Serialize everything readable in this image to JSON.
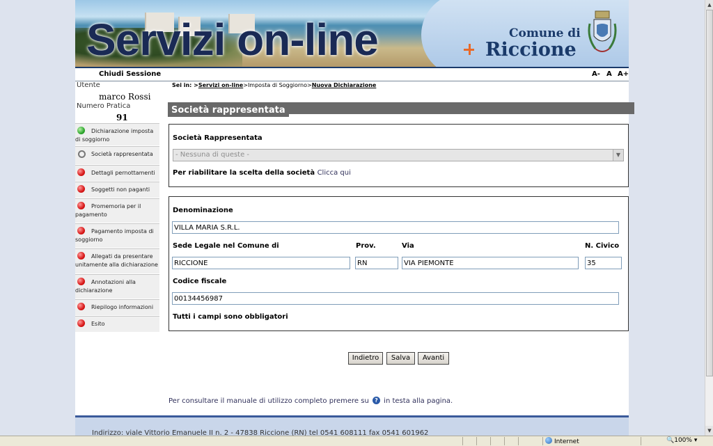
{
  "banner": {
    "title": "Servizi on-line",
    "comune_di": "Comune di",
    "riccione": "Riccione"
  },
  "topbar": {
    "close_session": "Chiudi Sessione",
    "font_smaller": "A-",
    "font_normal": "A",
    "font_larger": "A+"
  },
  "user": {
    "label": "Utente",
    "name": "marco Rossi",
    "practice_label": "Numero Pratica",
    "practice_number": "91"
  },
  "sidebar": {
    "items": [
      {
        "label": "Dichiarazione imposta di soggiorno",
        "status": "done"
      },
      {
        "label": "Società rappresentata",
        "status": "current"
      },
      {
        "label": "Dettagli pernottamenti",
        "status": "todo"
      },
      {
        "label": "Soggetti non paganti",
        "status": "todo"
      },
      {
        "label": "Promemoria per il pagamento",
        "status": "todo"
      },
      {
        "label": "Pagamento imposta di soggiorno",
        "status": "todo"
      },
      {
        "label": "Allegati da presentare unitamente alla dichiarazione",
        "status": "todo"
      },
      {
        "label": "Annotazioni alla dichiarazione",
        "status": "todo"
      },
      {
        "label": "Riepilogo informazioni",
        "status": "todo"
      },
      {
        "label": "Esito",
        "status": "todo"
      }
    ]
  },
  "breadcrumb": {
    "prefix": "Sei in: >",
    "item1": "Servizi on-line",
    "sep1": ">",
    "item2": "Imposta di Soggiorno",
    "sep2": ">",
    "item3": "Nuova Dichiarazione"
  },
  "section": {
    "title": "Società rappresentata"
  },
  "company_select": {
    "label": "Società Rappresentata",
    "selected": "- Nessuna di queste -",
    "reenable_text": "Per riabilitare la scelta della società",
    "reenable_link": "Clicca qui"
  },
  "form": {
    "denominazione_label": "Denominazione",
    "denominazione_value": "VILLA MARIA S.R.L.",
    "sede_label": "Sede Legale nel Comune di",
    "sede_value": "RICCIONE",
    "prov_label": "Prov.",
    "prov_value": "RN",
    "via_label": "Via",
    "via_value": "VIA PIEMONTE",
    "civico_label": "N. Civico",
    "civico_value": "35",
    "cf_label": "Codice fiscale",
    "cf_value": "00134456987",
    "required_note": "Tutti i campi sono obbligatori"
  },
  "buttons": {
    "back": "Indietro",
    "save": "Salva",
    "next": "Avanti"
  },
  "help": {
    "before": "Per consultare il manuale di utilizzo completo premere su",
    "after": "in testa alla pagina."
  },
  "footer": {
    "address": "Indirizzo: viale Vittorio Emanuele II n. 2 - 47838 Riccione (RN) tel 0541 608111 fax 0541 601962"
  },
  "statusbar": {
    "zone": "Internet",
    "zoom": "100%"
  },
  "colors": {
    "brand_blue": "#1a3a6a",
    "section_gray": "#696969",
    "error_red": "#d81818",
    "ok_green": "#2ea82e"
  }
}
